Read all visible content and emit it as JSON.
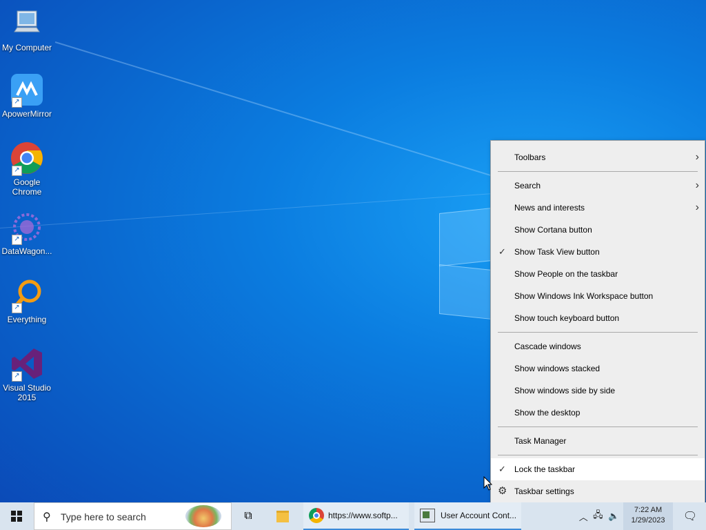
{
  "desktop": {
    "icons": [
      {
        "label": "My Computer",
        "icon": "computer-icon"
      },
      {
        "label": "ApowerMirror",
        "icon": "apowermirror-icon"
      },
      {
        "label": "Google Chrome",
        "icon": "chrome-icon"
      },
      {
        "label": "DataWagon...",
        "icon": "datawagon-icon"
      },
      {
        "label": "Everything",
        "icon": "everything-icon"
      },
      {
        "label": "Visual Studio 2015",
        "icon": "visual-studio-icon"
      }
    ]
  },
  "context_menu": {
    "items": [
      {
        "label": "Toolbars",
        "submenu": true
      },
      {
        "label": "Search",
        "submenu": true
      },
      {
        "label": "News and interests",
        "submenu": true
      },
      {
        "label": "Show Cortana button"
      },
      {
        "label": "Show Task View button",
        "checked": true
      },
      {
        "label": "Show People on the taskbar"
      },
      {
        "label": "Show Windows Ink Workspace button"
      },
      {
        "label": "Show touch keyboard button"
      },
      {
        "label": "Cascade windows"
      },
      {
        "label": "Show windows stacked"
      },
      {
        "label": "Show windows side by side"
      },
      {
        "label": "Show the desktop"
      },
      {
        "label": "Task Manager"
      },
      {
        "label": "Lock the taskbar",
        "checked": true,
        "highlighted": true
      },
      {
        "label": "Taskbar settings",
        "icon": "gear-icon"
      }
    ]
  },
  "taskbar": {
    "search_placeholder": "Type here to search",
    "apps": [
      {
        "label": "https://www.softp...",
        "icon": "chrome-icon"
      },
      {
        "label": "User Account Cont...",
        "icon": "uac-icon"
      }
    ],
    "clock_time": "7:22 AM",
    "clock_date": "1/29/2023"
  }
}
